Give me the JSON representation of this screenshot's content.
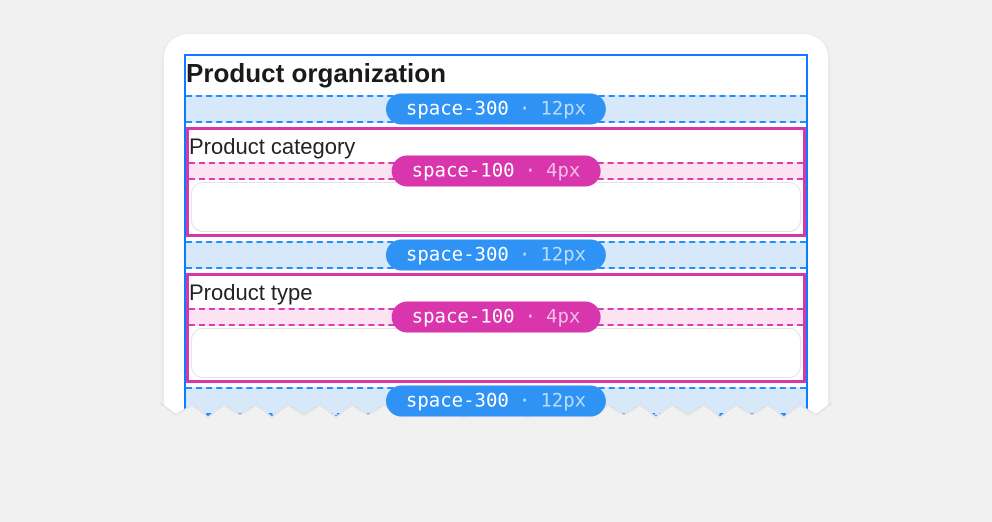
{
  "card": {
    "heading": "Product organization",
    "fields": [
      {
        "label": "Product category"
      },
      {
        "label": "Product type"
      }
    ]
  },
  "tokens": {
    "space300": {
      "token": "space-300",
      "px": "12px"
    },
    "space100": {
      "token": "space-100",
      "px": "4px"
    }
  },
  "colors": {
    "blue": "#2f93f6",
    "pink": "#d935ac",
    "page_bg": "#f1f1f1"
  }
}
